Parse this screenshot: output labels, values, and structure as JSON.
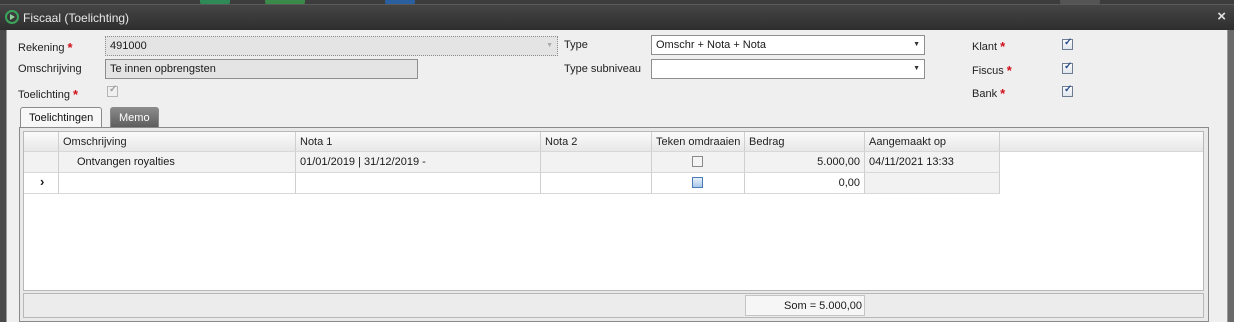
{
  "window": {
    "title": "Fiscaal (Toelichting)",
    "close_glyph": "×"
  },
  "form": {
    "rekening_label": "Rekening",
    "rekening_value": "491000",
    "omschrijving_label": "Omschrijving",
    "omschrijving_value": "Te innen opbrengsten",
    "toelichting_label": "Toelichting",
    "type_label": "Type",
    "type_value": "Omschr + Nota + Nota",
    "type_subniveau_label": "Type subniveau",
    "type_subniveau_value": "",
    "klant_label": "Klant",
    "fiscus_label": "Fiscus",
    "bank_label": "Bank",
    "required_marker": "*"
  },
  "tabs": [
    {
      "label": "Toelichtingen"
    },
    {
      "label": "Memo"
    }
  ],
  "grid": {
    "columns": [
      "Omschrijving",
      "Nota 1",
      "Nota 2",
      "Teken omdraaien",
      "Bedrag",
      "Aangemaakt op"
    ],
    "rows": [
      {
        "omschrijving": "Ontvangen royalties",
        "nota1": "01/01/2019 | 31/12/2019 -",
        "nota2": "",
        "bedrag": "5.000,00",
        "aangemaakt": "04/11/2021 13:33"
      },
      {
        "omschrijving": "",
        "nota1": "",
        "nota2": "",
        "bedrag": "0,00",
        "aangemaakt": ""
      }
    ],
    "new_row_indicator": "›",
    "sum": "Som = 5.000,00"
  },
  "colors": {
    "accent": "#2b4f8c",
    "required": "#d0101a",
    "titlebar": "#3a3a3a"
  }
}
